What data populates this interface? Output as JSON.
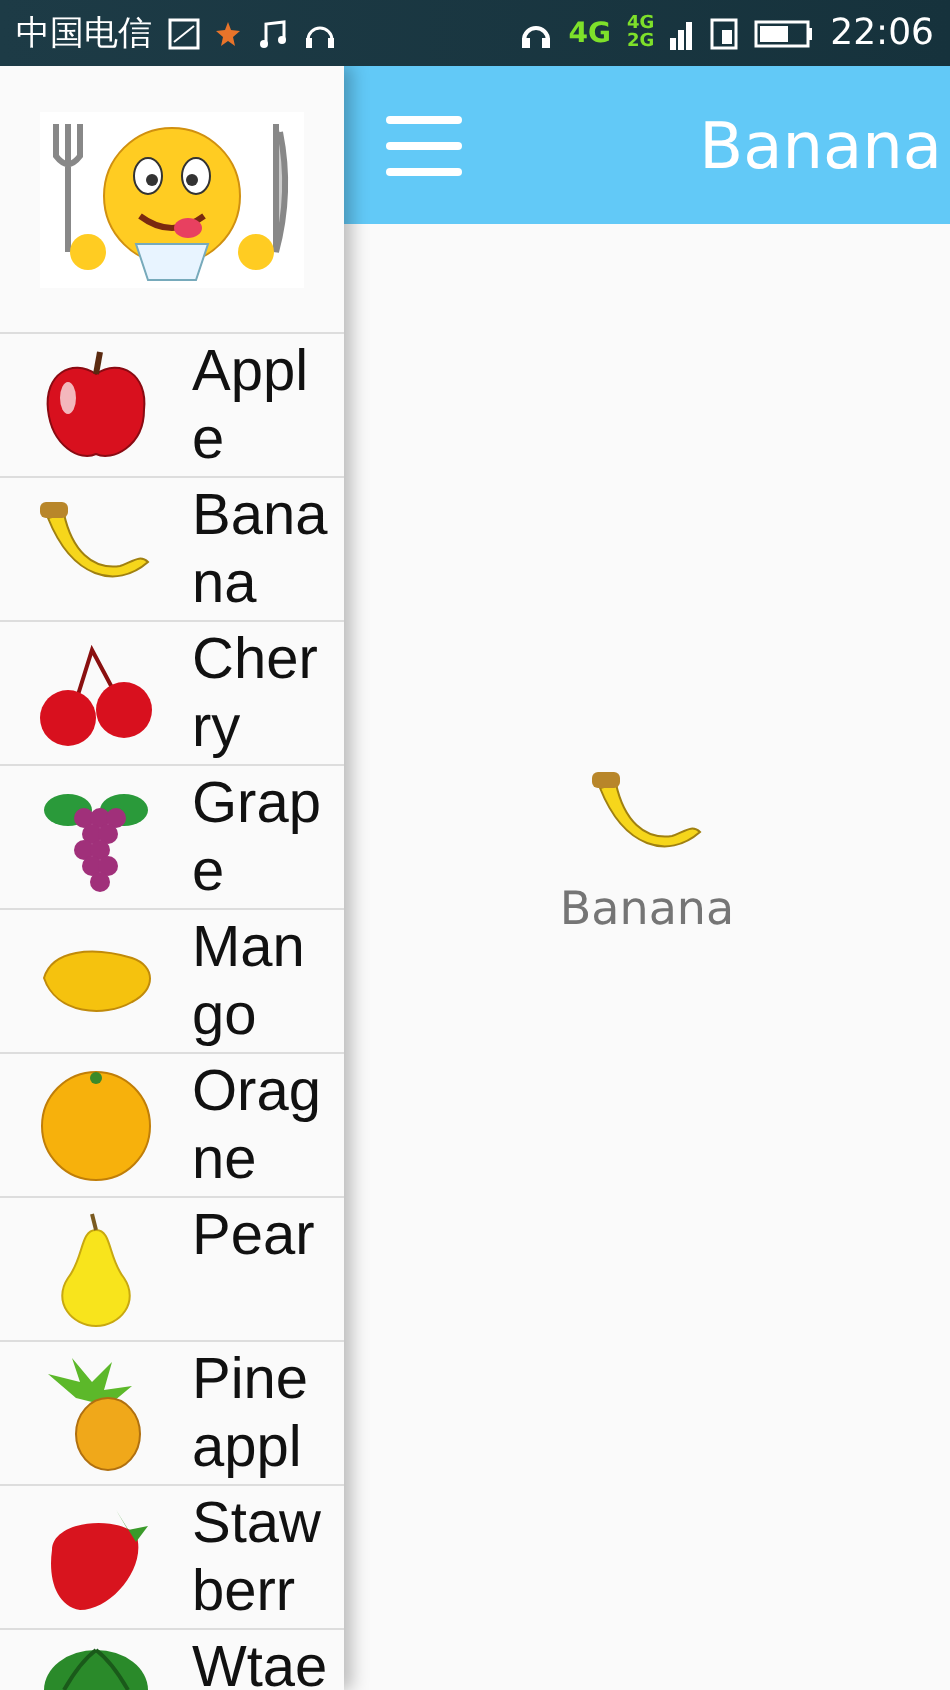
{
  "status_bar": {
    "carrier": "中国电信",
    "network": "4G",
    "network_sub_top": "4G",
    "network_sub_bottom": "2G",
    "time": "22:06"
  },
  "drawer": {
    "items": [
      {
        "label": "Apple"
      },
      {
        "label": "Banana"
      },
      {
        "label": "Cherry"
      },
      {
        "label": "Grape"
      },
      {
        "label": "Mango"
      },
      {
        "label": "Oragne"
      },
      {
        "label": "Pear"
      },
      {
        "label": "Pineappl"
      },
      {
        "label": "Stawberr"
      },
      {
        "label": "Wtae"
      }
    ]
  },
  "toolbar": {
    "title": "Banana"
  },
  "content": {
    "caption": "Banana"
  }
}
